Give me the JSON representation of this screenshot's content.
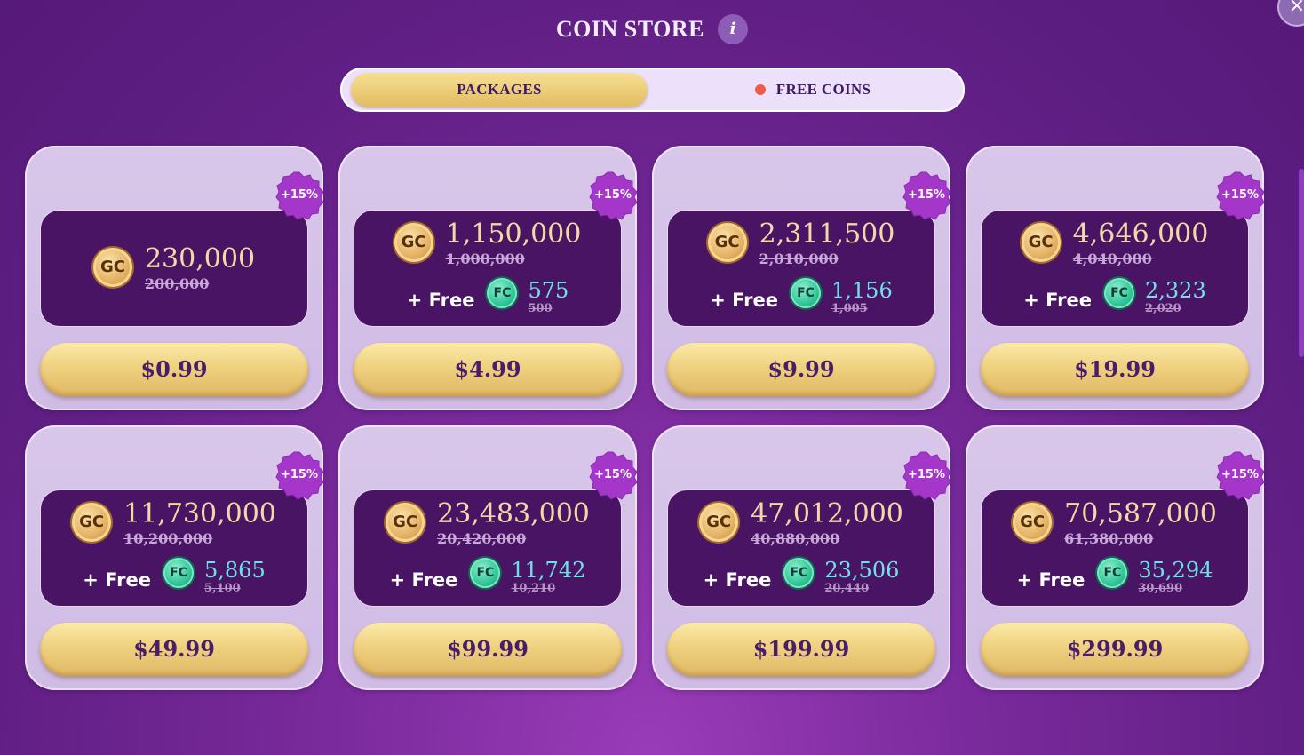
{
  "header": {
    "title": "COIN STORE",
    "info_icon_label": "i",
    "close_icon_label": "×"
  },
  "tabs": {
    "packages": "PACKAGES",
    "free_coins": "FREE COINS"
  },
  "colors": {
    "gold": "#f1d9a6",
    "teal": "#6fe1e6",
    "purple_panel": "#4a1464",
    "badge": "#a437c9",
    "dot": "#f15a4a"
  },
  "icons": {
    "gold_coin": "GC",
    "free_coin": "FC"
  },
  "packages": [
    {
      "badge": "+15%",
      "gc_amount": "230,000",
      "gc_old": "200,000",
      "free_label": "",
      "fc_amount": "",
      "fc_old": "",
      "price": "$0.99"
    },
    {
      "badge": "+15%",
      "gc_amount": "1,150,000",
      "gc_old": "1,000,000",
      "free_label": "+ Free",
      "fc_amount": "575",
      "fc_old": "500",
      "price": "$4.99"
    },
    {
      "badge": "+15%",
      "gc_amount": "2,311,500",
      "gc_old": "2,010,000",
      "free_label": "+ Free",
      "fc_amount": "1,156",
      "fc_old": "1,005",
      "price": "$9.99"
    },
    {
      "badge": "+15%",
      "gc_amount": "4,646,000",
      "gc_old": "4,040,000",
      "free_label": "+ Free",
      "fc_amount": "2,323",
      "fc_old": "2,020",
      "price": "$19.99"
    },
    {
      "badge": "+15%",
      "gc_amount": "11,730,000",
      "gc_old": "10,200,000",
      "free_label": "+ Free",
      "fc_amount": "5,865",
      "fc_old": "5,100",
      "price": "$49.99"
    },
    {
      "badge": "+15%",
      "gc_amount": "23,483,000",
      "gc_old": "20,420,000",
      "free_label": "+ Free",
      "fc_amount": "11,742",
      "fc_old": "10,210",
      "price": "$99.99"
    },
    {
      "badge": "+15%",
      "gc_amount": "47,012,000",
      "gc_old": "40,880,000",
      "free_label": "+ Free",
      "fc_amount": "23,506",
      "fc_old": "20,440",
      "price": "$199.99"
    },
    {
      "badge": "+15%",
      "gc_amount": "70,587,000",
      "gc_old": "61,380,000",
      "free_label": "+ Free",
      "fc_amount": "35,294",
      "fc_old": "30,690",
      "price": "$299.99"
    }
  ]
}
